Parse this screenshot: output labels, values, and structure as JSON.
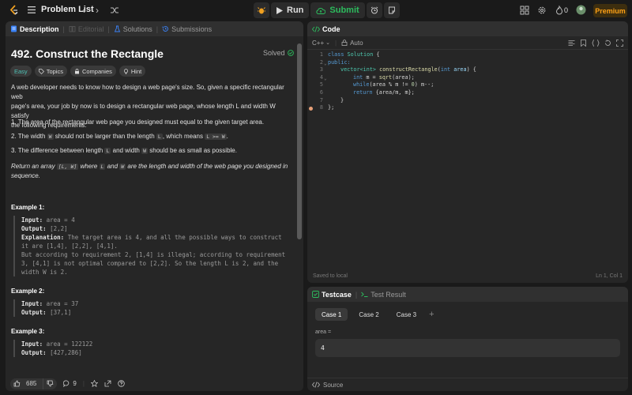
{
  "topbar": {
    "problem_list": "Problem List",
    "run": "Run",
    "submit": "Submit",
    "streak": "0",
    "premium": "Premium"
  },
  "description_tabs": [
    "Description",
    "Editorial",
    "Solutions",
    "Submissions"
  ],
  "problem": {
    "title": "492. Construct the Rectangle",
    "status": "Solved",
    "tags": [
      "Easy",
      "Topics",
      "Companies",
      "Hint"
    ],
    "intro_1": "A web developer needs to know how to design a web page's size. So, given a specific rectangular web",
    "intro_2": "page's area, your job by now is to design a rectangular web page, whose length L and width W satisfy",
    "intro_3": "the following requirements:",
    "req_1": "1. The area of the rectangular web page you designed must equal to the given target area.",
    "req_2_a": "2. The width ",
    "req_2_code_1": "W",
    "req_2_b": " should not be larger than the length ",
    "req_2_code_2": "L",
    "req_2_c": ", which means ",
    "req_2_code_3": "L >= W",
    "req_2_d": ".",
    "req_3_a": "3. The difference between length ",
    "req_3_code_1": "L",
    "req_3_b": " and width ",
    "req_3_code_2": "W",
    "req_3_c": " should be as small as possible.",
    "ret_a": "Return an array ",
    "ret_code": "[L, W]",
    "ret_b": " where ",
    "ret_code_2": "L",
    "ret_c": " and ",
    "ret_code_3": "W",
    "ret_d": " are the length and width of the web page you designed in",
    "ret_e": "sequence."
  },
  "examples": [
    {
      "heading": "Example 1:",
      "input_label": "Input:",
      "input": " area = 4",
      "output_label": "Output:",
      "output": " [2,2]",
      "expl_label": "Explanation:",
      "expl_1": " The target area is 4, and all the possible ways to construct",
      "expl_2": "it are [1,4], [2,2], [4,1].",
      "expl_3": "But according to requirement 2, [1,4] is illegal; according to requirement",
      "expl_4": "3,  [4,1] is not optimal compared to [2,2]. So the length L is 2, and the",
      "expl_5": "width W is 2."
    },
    {
      "heading": "Example 2:",
      "input_label": "Input:",
      "input": " area = 37",
      "output_label": "Output:",
      "output": " [37,1]"
    },
    {
      "heading": "Example 3:",
      "input_label": "Input:",
      "input": " area = 122122",
      "output_label": "Output:",
      "output": " [427,286]"
    }
  ],
  "desc_footer": {
    "likes": "685",
    "comments": "9"
  },
  "code_panel": {
    "title": "Code",
    "language": "C++",
    "mode": "Auto",
    "line_numbers": [
      "1",
      "2",
      "3",
      "4",
      "5",
      "6",
      "7",
      "8"
    ],
    "saved": "Saved to local",
    "cursor": "Ln 1, Col 1"
  },
  "code_lines": {
    "l1_kw": "class",
    "l1_name": " Solution",
    "l1_rest": " {",
    "l2": "public:",
    "l3_ty": "vector<int>",
    "l3_fn": " constructRectangle",
    "l3_p1": "(",
    "l3_ty2": "int",
    "l3_pa": " area",
    "l3_end": ") {",
    "l4_ty": "int",
    "l4_rest": " m = ",
    "l4_fn": "sqrt",
    "l4_end": "(area);",
    "l5_kw": "while",
    "l5_rest": "(area % m != ",
    "l5_nm": "0",
    "l5_end": ") m--;",
    "l6_kw": "return",
    "l6_rest": " {area/m, m};",
    "l7": "}",
    "l8": "};"
  },
  "test_panel": {
    "tabs": [
      "Testcase",
      "Test Result"
    ],
    "cases": [
      "Case 1",
      "Case 2",
      "Case 3"
    ],
    "plus": "+",
    "var_label": "area =",
    "var_value": "4",
    "source": "Source"
  },
  "colors": {
    "accent": "#ffa116",
    "success": "#2cbb5d",
    "easy": "#4ec0b5"
  }
}
